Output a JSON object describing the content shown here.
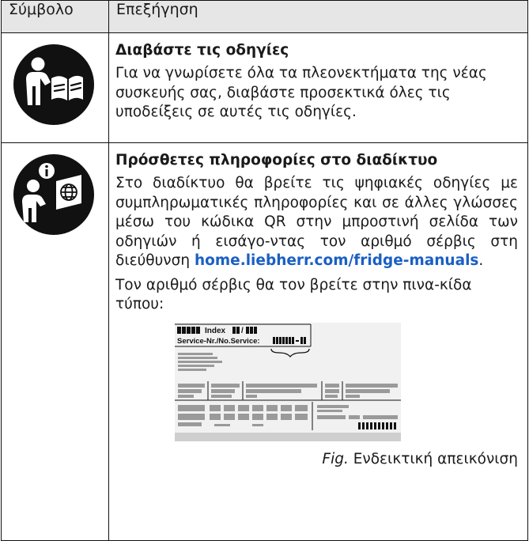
{
  "table": {
    "header": {
      "symbol": "Σύμβολο",
      "explanation": "Επεξήγηση"
    },
    "rows": [
      {
        "icon": "read-instructions-icon",
        "title": "Διαβάστε τις οδηγίες",
        "text": "Για να γνωρίσετε όλα τα πλεονεκτήματα της νέας συσκευής σας, διαβάστε προσεκτικά όλες τις υποδείξεις σε αυτές τις οδηγίες."
      },
      {
        "icon": "online-info-icon",
        "title": "Πρόσθετες πληροφορίες στο διαδίκτυο",
        "text": "Στο διαδίκτυο θα βρείτε τις ψηφιακές οδηγίες με συμπληρωματικές πληροφορίες και σε άλλες γλώσσες μέσω του κώδικα QR στην μπροστινή σελίδα των οδηγιών ή εισάγο-ντας τον αριθμό σέρβις στη διεύθυνση",
        "link": "home.liebherr.com/fridge-manuals",
        "link_suffix": ".",
        "text2": "Τον αριθμό σέρβις θα τον βρείτε στην πινα-κίδα τύπου:",
        "plate": {
          "index_label": "Index",
          "service_label": "Service-Nr./No.Service:"
        },
        "caption_fig": "Fig.",
        "caption_text": "Ενδεικτική απεικόνιση"
      }
    ]
  },
  "colors": {
    "header_bg": "#e6e6e6",
    "link": "#1a5fc4",
    "icon": "#111111"
  }
}
